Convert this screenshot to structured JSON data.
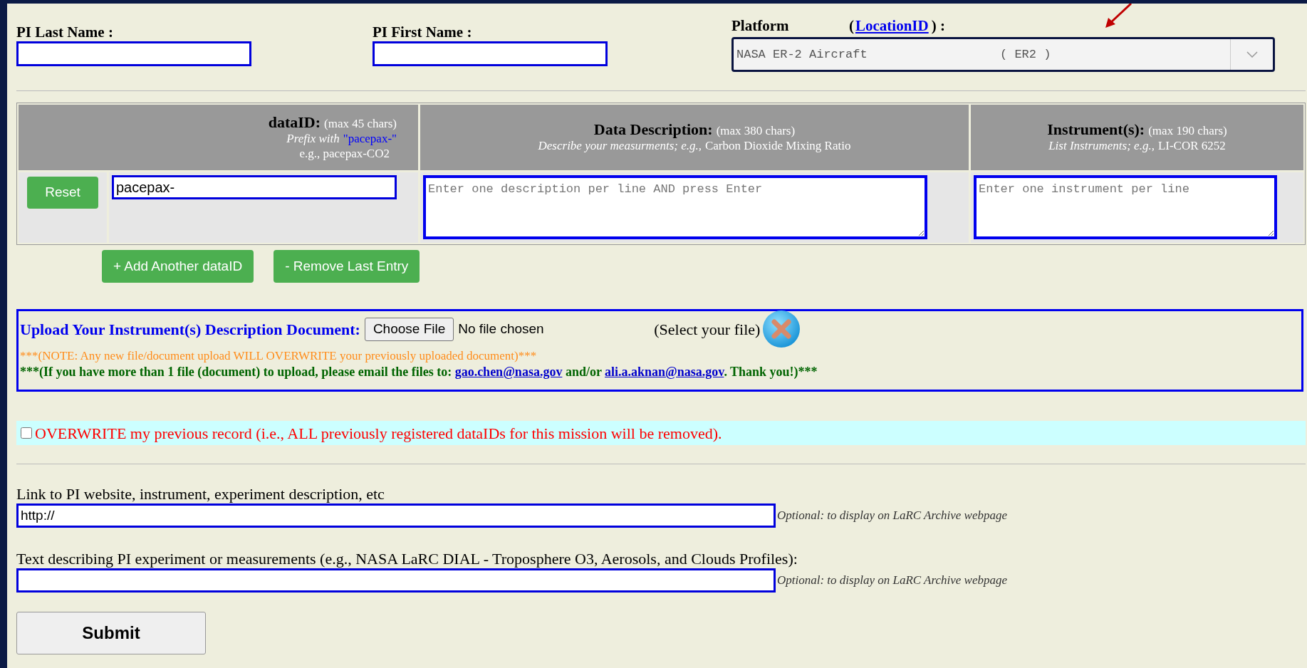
{
  "name_fields": [
    {
      "label": "PI Last Name :"
    },
    {
      "label": "PI First Name :"
    }
  ],
  "platform": {
    "label": "Platform",
    "link_open": "(",
    "link": "LocationID",
    "link_close": ") :",
    "selected_name": "NASA ER-2 Aircraft",
    "selected_code": "( ER2 )"
  },
  "table": {
    "columns": [
      {
        "kind": "dataid",
        "title": "dataID:",
        "max": "(max 45 chars)",
        "hint": "Prefix with",
        "hint_value": "\"pacepax-\"",
        "example": "e.g., pacepax-CO2"
      },
      {
        "kind": "text",
        "title": "Data Description:",
        "max": "(max 380 chars)",
        "hint": "Describe your measurments; e.g.,",
        "example": "Carbon Dioxide Mixing Ratio"
      },
      {
        "kind": "text",
        "title": "Instrument(s):",
        "max": "(max 190 chars)",
        "hint": "List Instruments; e.g.,",
        "example": "LI-COR 6252"
      }
    ],
    "row": {
      "reset": "Reset",
      "dataid": "pacepax-",
      "description_placeholder": "Enter one description per line AND press Enter",
      "instrument_placeholder": "Enter one instrument per line"
    }
  },
  "row_buttons": [
    "+ Add Another dataID",
    "- Remove Last Entry"
  ],
  "upload": {
    "title": "Upload Your Instrument(s) Description Document:",
    "choose": "Choose File",
    "status": "No file chosen",
    "select_hint": "(Select your file)",
    "note": "***(NOTE: Any new file/document upload WILL OVERWRITE your previously uploaded document)***",
    "notice_prefix": "***(If you have more than 1 file (document) to upload, please email the files to:",
    "email_1": "gao.chen@nasa.gov",
    "notice_mid": "and/or",
    "email_2": "ali.a.aknan@nasa.gov",
    "notice_suffix": ". Thank you!)***"
  },
  "overwrite": {
    "checked": false,
    "label": "OVERWRITE my previous record (i.e., ALL previously registered dataIDs for this mission will be removed)."
  },
  "extra_fields": [
    {
      "label": "Link to PI website, instrument, experiment description, etc",
      "value": "http://",
      "hint": "Optional: to display on LaRC Archive webpage"
    },
    {
      "label": "Text describing PI experiment or measurements (e.g., NASA LaRC DIAL - Troposphere O3, Aerosols, and Clouds Profiles):",
      "hint": "Optional: to display on LaRC Archive webpage"
    }
  ],
  "submit": "Submit"
}
